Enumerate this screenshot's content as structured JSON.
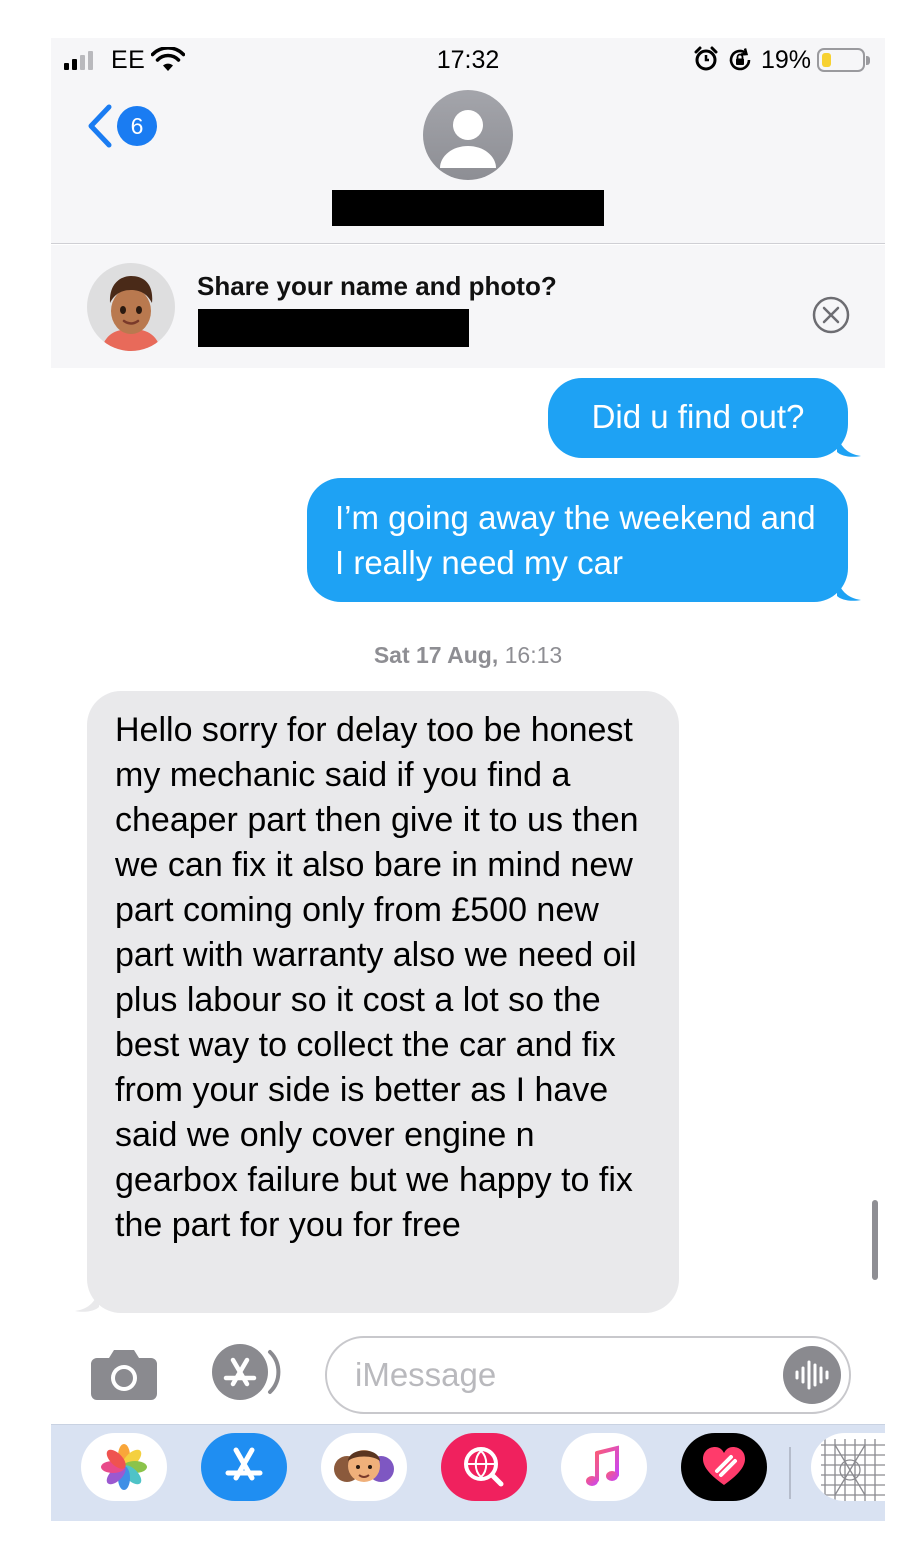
{
  "status_bar": {
    "carrier": "EE",
    "time": "17:32",
    "battery_percent": "19%",
    "battery_level": 0.19,
    "signal_bars": 2
  },
  "nav": {
    "back_count": "6",
    "accent_color": "#1a7cf2"
  },
  "share_banner": {
    "title": "Share your name and photo?"
  },
  "messages": [
    {
      "direction": "outgoing",
      "text": "Did u find out?"
    },
    {
      "direction": "outgoing",
      "text": "I’m going away the weekend and I really need my car"
    },
    {
      "direction": "incoming",
      "text": "Hello sorry for delay too be honest my mechanic said if you find a cheaper part then give it to us then we can fix it also bare in mind new part coming only from £500 new part with warranty also we need oil plus labour so it cost a lot so the best way to collect the car and fix from your side is better as I have said we only cover engine n gearbox failure but we happy to fix the part for you for free"
    }
  ],
  "timestamp": {
    "day": "Sat 17 Aug,",
    "time": "16:13"
  },
  "composer": {
    "placeholder": "iMessage"
  },
  "app_drawer": {
    "apps": [
      "photos-icon",
      "app-store-icon",
      "memoji-icon",
      "web-search-icon",
      "music-icon",
      "digital-touch-icon",
      "more-apps-icon"
    ]
  },
  "colors": {
    "outgoing_bubble": "#1ea2f4",
    "incoming_bubble": "#e9e9eb"
  }
}
